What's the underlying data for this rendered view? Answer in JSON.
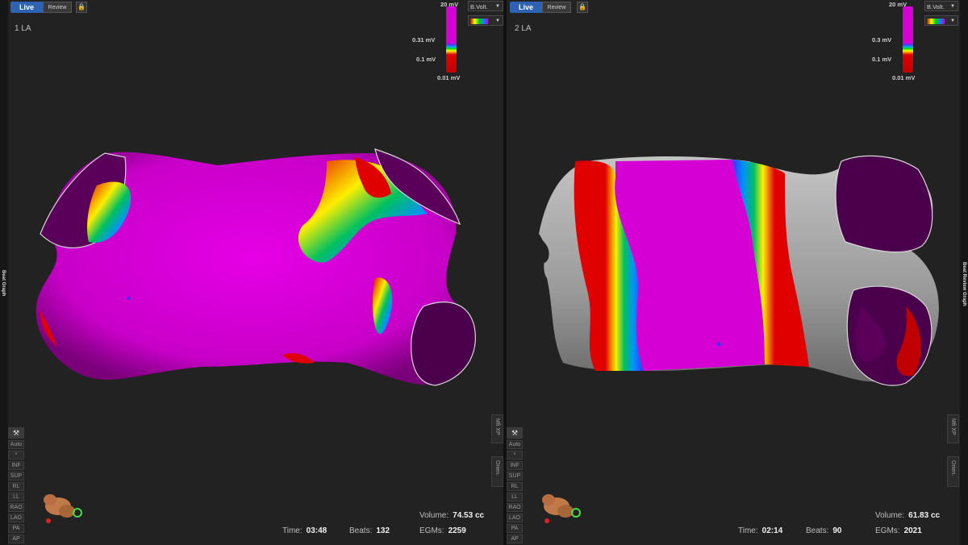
{
  "left_edge_label": "Beat Graph",
  "right_edge_label": "Beat Review Graph",
  "panes": [
    {
      "map_title": "1 LA",
      "mode_live": "Live",
      "mode_review": "Review",
      "colorbar": {
        "top": "20 mV",
        "upper": "0.31 mV",
        "lower": "0.1 mV",
        "bottom": "0.01 mV"
      },
      "map_type": "B.Volt.",
      "side_buttons": [
        "Auto",
        "*",
        "INF",
        "SUP",
        "RL",
        "LL",
        "RAO",
        "LAO",
        "PA",
        "AP"
      ],
      "right_tabs": [
        "Mfi XP",
        "Orien."
      ],
      "stats": {
        "volume_label": "Volume:",
        "volume": "74.53 cc",
        "time_label": "Time:",
        "time": "03:48",
        "beats_label": "Beats:",
        "beats": "132",
        "egms_label": "EGMs:",
        "egms": "2259"
      }
    },
    {
      "map_title": "2 LA",
      "mode_live": "Live",
      "mode_review": "Review",
      "colorbar": {
        "top": "20 mV",
        "upper": "0.3 mV",
        "lower": "0.1 mV",
        "bottom": "0.01 mV"
      },
      "map_type": "B.Volt.",
      "side_buttons": [
        "Auto",
        "*",
        "INF",
        "SUP",
        "RL",
        "LL",
        "RAO",
        "LAO",
        "PA",
        "AP"
      ],
      "right_tabs": [
        "Mfi XP",
        "Orien."
      ],
      "stats": {
        "volume_label": "Volume:",
        "volume": "61.83 cc",
        "time_label": "Time:",
        "time": "02:14",
        "beats_label": "Beats:",
        "beats": "90",
        "egms_label": "EGMs:",
        "egms": "2021"
      }
    }
  ],
  "colors": {
    "healthy": "#d400d4",
    "scar": "#e00000",
    "unmapped": "#a8a8a8",
    "live_accent": "#2e62b3"
  },
  "icons": {
    "lock": "lock-icon",
    "tool": "hammer-icon",
    "orientation": "heart-orientation-icon"
  }
}
